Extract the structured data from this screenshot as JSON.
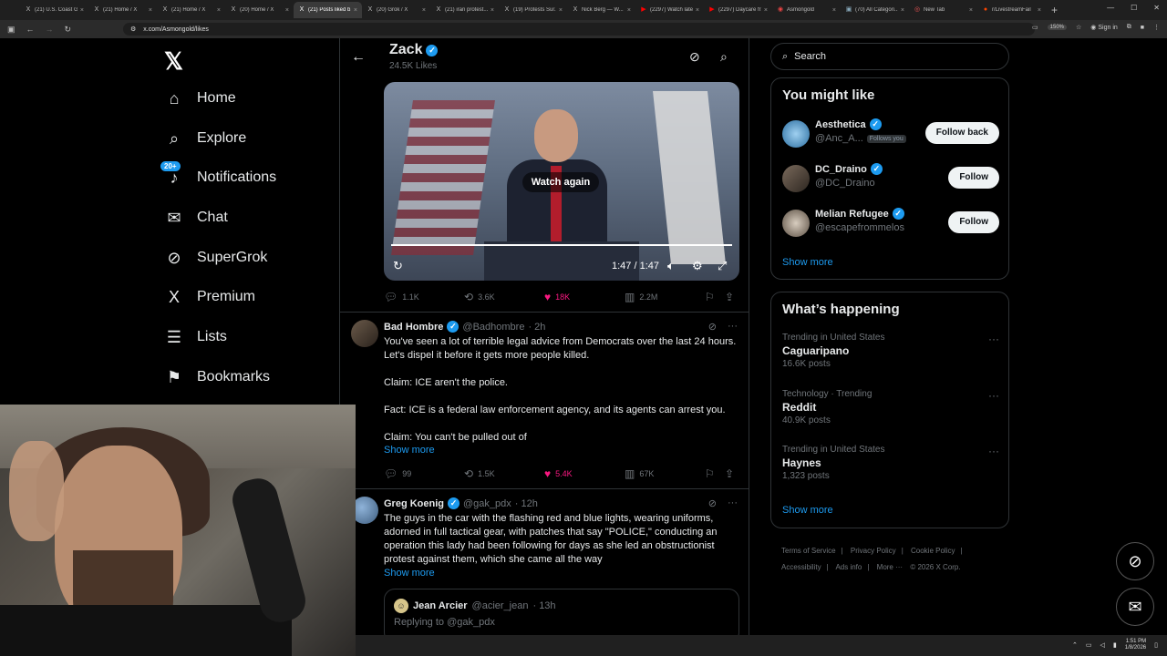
{
  "browser": {
    "tabs": [
      {
        "label": "(21) U.S. Coast G...",
        "icon": "X"
      },
      {
        "label": "(21) Home / X",
        "icon": "X"
      },
      {
        "label": "(21) Home / X",
        "icon": "X"
      },
      {
        "label": "(20) Home / X",
        "icon": "X"
      },
      {
        "label": "(21) Posts liked b...",
        "icon": "X",
        "active": true
      },
      {
        "label": "(20) Grok / X",
        "icon": "X"
      },
      {
        "label": "(21) iran protest...",
        "icon": "X"
      },
      {
        "label": "(19) Protests Sur...",
        "icon": "X"
      },
      {
        "label": "Nick Berg — W...",
        "icon": "X"
      },
      {
        "label": "(2297) Watch late...",
        "icon": "▶"
      },
      {
        "label": "(2297) Daycare fr...",
        "icon": "▶"
      },
      {
        "label": "Asmongold",
        "icon": "◉"
      },
      {
        "label": "(70) All Categori...",
        "icon": "▣"
      },
      {
        "label": "New Tab",
        "icon": "◎"
      },
      {
        "label": "r/LivestreamFail",
        "icon": "●"
      }
    ],
    "url": "x.com/Asmongold/likes",
    "zoom": "150%",
    "sign_in": "Sign in"
  },
  "nav": {
    "items": [
      {
        "label": "Home",
        "icon": "⌂"
      },
      {
        "label": "Explore",
        "icon": "⌕"
      },
      {
        "label": "Notifications",
        "icon": "♪",
        "badge": "20+"
      },
      {
        "label": "Chat",
        "icon": "✉"
      },
      {
        "label": "SuperGrok",
        "icon": "⊘"
      },
      {
        "label": "Premium",
        "icon": "X"
      },
      {
        "label": "Lists",
        "icon": "☰"
      },
      {
        "label": "Bookmarks",
        "icon": "⚑"
      }
    ]
  },
  "header": {
    "name": "Zack",
    "likes": "24.5K Likes"
  },
  "video": {
    "watch_again": "Watch again",
    "time": "1:47 / 1:47"
  },
  "post1_actions": {
    "replies": "1.1K",
    "reposts": "3.6K",
    "likes": "18K",
    "views": "2.2M"
  },
  "post2": {
    "name": "Bad Hombre",
    "handle": "@Badhombre",
    "time": "· 2h",
    "lines": [
      "You've seen a lot of terrible legal advice from Democrats over the last 24 hours. Let's dispel it before it gets more people killed.",
      "",
      "Claim: ICE aren't the police.",
      "",
      "Fact: ICE is a federal law enforcement agency, and its agents can arrest you.",
      "",
      "Claim: You can't be pulled out of"
    ],
    "show_more": "Show more",
    "replies": "99",
    "reposts": "1.5K",
    "likes": "5.4K",
    "views": "67K"
  },
  "post3": {
    "name": "Greg Koenig",
    "handle": "@gak_pdx",
    "time": "· 12h",
    "text": "The guys in the car with the flashing red and blue lights, wearing uniforms, adorned in full tactical gear, with patches that say \"POLICE,\" conducting an operation this lady had been following for days as she led an obstructionist protest against them, which she came all the way",
    "show_more": "Show more",
    "quote": {
      "name": "Jean Arcier",
      "handle": "@acier_jean",
      "time": "· 13h",
      "sub": "Replying to @gak_pdx"
    }
  },
  "search": {
    "placeholder": "Search"
  },
  "might_like": {
    "title": "You might like",
    "items": [
      {
        "name": "Aesthetica",
        "handle": "@Anc_A...",
        "follows_you": "Follows you",
        "button": "Follow back"
      },
      {
        "name": "DC_Draino",
        "handle": "@DC_Draino",
        "button": "Follow"
      },
      {
        "name": "Melian Refugee",
        "handle": "@escapefrommelos",
        "button": "Follow"
      }
    ],
    "show_more": "Show more"
  },
  "happening": {
    "title": "What’s happening",
    "items": [
      {
        "meta": "Trending in United States",
        "name": "Caguaripano",
        "count": "16.6K posts"
      },
      {
        "meta": "Technology · Trending",
        "name": "Reddit",
        "count": "40.9K posts"
      },
      {
        "meta": "Trending in United States",
        "name": "Haynes",
        "count": "1,323 posts"
      }
    ],
    "show_more": "Show more"
  },
  "footer": {
    "links": [
      "Terms of Service",
      "|",
      "Privacy Policy",
      "|",
      "Cookie Policy",
      "|",
      "Accessibility",
      "|",
      "Ads info",
      "|",
      "More ···",
      "© 2026 X Corp."
    ]
  },
  "taskbar": {
    "time": "1:51 PM",
    "date": "1/8/2026"
  },
  "colors": {
    "accent": "#1d9bf0",
    "like": "#f91880",
    "border": "#2f3336"
  }
}
